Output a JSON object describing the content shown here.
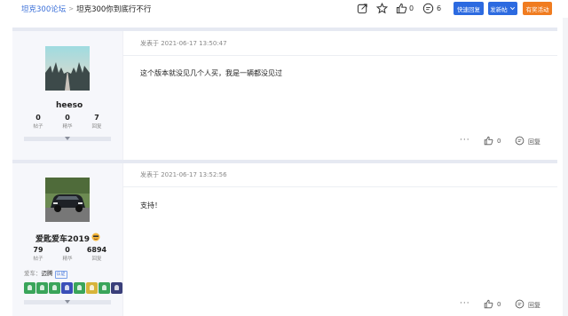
{
  "breadcrumb": {
    "forum": "坦克300论坛",
    "separator": ">",
    "thread": "坦克300你到底行不行"
  },
  "toolbar": {
    "like_count": "0",
    "comment_count": "6",
    "quick_reply": "快速回复",
    "new_post": "发新帖",
    "prize_event": "有奖活动"
  },
  "posts": [
    {
      "user": {
        "name": "heeso",
        "stats": [
          {
            "value": "0",
            "label": "帖子"
          },
          {
            "value": "0",
            "label": "精华"
          },
          {
            "value": "7",
            "label": "回复"
          }
        ]
      },
      "time": "发表于 2021-06-17 13:50:47",
      "text": "这个版本就没见几个人买，我是一辆都没见过",
      "actions": {
        "more": "···",
        "likes": "0",
        "reply": "回复"
      }
    },
    {
      "user": {
        "name": "爱匙爱车2019",
        "stats": [
          {
            "value": "79",
            "label": "帖子"
          },
          {
            "value": "0",
            "label": "精华"
          },
          {
            "value": "6894",
            "label": "回复"
          }
        ],
        "car_label": "爱车：",
        "car": "迈腾",
        "car_verified": "认证"
      },
      "time": "发表于 2021-06-17 13:52:56",
      "text": "支持！",
      "actions": {
        "more": "···",
        "likes": "0",
        "reply": "回复"
      }
    }
  ],
  "colors": {
    "accent": "#2c6ae0",
    "orange": "#f07c20",
    "link": "#3a6fd8"
  }
}
